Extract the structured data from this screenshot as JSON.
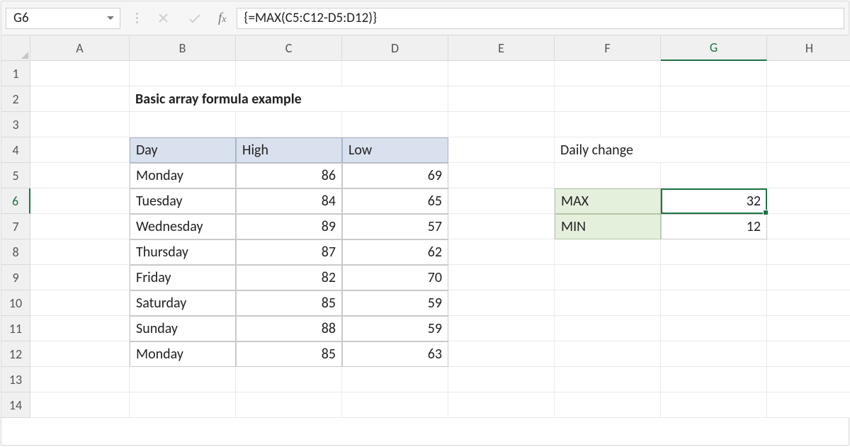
{
  "name_box": "G6",
  "formula": "{=MAX(C5:C12-D5:D12)}",
  "columns": [
    "A",
    "B",
    "C",
    "D",
    "E",
    "F",
    "G",
    "H"
  ],
  "rows": [
    "1",
    "2",
    "3",
    "4",
    "5",
    "6",
    "7",
    "8",
    "9",
    "10",
    "11",
    "12",
    "13",
    "14"
  ],
  "title": "Basic array formula example",
  "headers": {
    "day": "Day",
    "high": "High",
    "low": "Low"
  },
  "daily_change_label": "Daily change",
  "data": [
    {
      "day": "Monday",
      "high": "86",
      "low": "69"
    },
    {
      "day": "Tuesday",
      "high": "84",
      "low": "65"
    },
    {
      "day": "Wednesday",
      "high": "89",
      "low": "57"
    },
    {
      "day": "Thursday",
      "high": "87",
      "low": "62"
    },
    {
      "day": "Friday",
      "high": "82",
      "low": "70"
    },
    {
      "day": "Saturday",
      "high": "85",
      "low": "59"
    },
    {
      "day": "Sunday",
      "high": "88",
      "low": "59"
    },
    {
      "day": "Monday",
      "high": "85",
      "low": "63"
    }
  ],
  "summary": {
    "max_label": "MAX",
    "max_val": "32",
    "min_label": "MIN",
    "min_val": "12"
  }
}
